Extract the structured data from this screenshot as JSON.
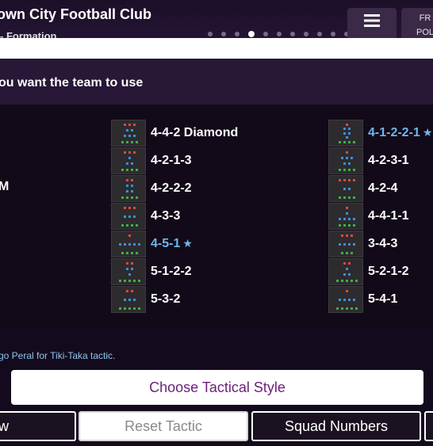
{
  "header": {
    "club_name": "own City Football Club",
    "subtitle": "- Formation",
    "page_count": 14,
    "active_page": 3,
    "right_button_label": "FR",
    "right_button_sub": "POL"
  },
  "question": "ou want the team to use",
  "left_label": "M",
  "formations": {
    "column1": [
      {
        "name": "4-4-2 Diamond",
        "highlight": false,
        "star": false,
        "lines": [
          [
            3
          ],
          [
            1,
            1
          ],
          [
            1,
            1,
            1
          ],
          [
            4
          ]
        ]
      },
      {
        "name": "4-2-1-3",
        "highlight": false,
        "star": false,
        "lines": [
          [
            3
          ],
          [
            1
          ],
          [
            2
          ],
          [
            4
          ]
        ]
      },
      {
        "name": "4-2-2-2",
        "highlight": false,
        "star": false,
        "lines": [
          [
            2
          ],
          [
            2
          ],
          [
            2
          ],
          [
            4
          ]
        ]
      },
      {
        "name": "4-3-3",
        "highlight": false,
        "star": false,
        "lines": [
          [
            3
          ],
          [
            3
          ],
          [
            4
          ]
        ]
      },
      {
        "name": "4-5-1",
        "highlight": true,
        "star": true,
        "lines": [
          [
            1
          ],
          [
            5
          ],
          [
            4
          ]
        ]
      },
      {
        "name": "5-1-2-2",
        "highlight": false,
        "star": false,
        "lines": [
          [
            2
          ],
          [
            2
          ],
          [
            1
          ],
          [
            5
          ]
        ]
      },
      {
        "name": "5-3-2",
        "highlight": false,
        "star": false,
        "lines": [
          [
            2
          ],
          [
            3
          ],
          [
            5
          ]
        ]
      }
    ],
    "column2": [
      {
        "name": "4-1-2-2-1",
        "highlight": true,
        "star": true,
        "lines": [
          [
            1
          ],
          [
            2
          ],
          [
            2
          ],
          [
            1
          ],
          [
            4
          ]
        ]
      },
      {
        "name": "4-2-3-1",
        "highlight": false,
        "star": false,
        "lines": [
          [
            1
          ],
          [
            3
          ],
          [
            2
          ],
          [
            4
          ]
        ]
      },
      {
        "name": "4-2-4",
        "highlight": false,
        "star": false,
        "lines": [
          [
            4
          ],
          [
            2
          ],
          [
            4
          ]
        ]
      },
      {
        "name": "4-4-1-1",
        "highlight": false,
        "star": false,
        "lines": [
          [
            1
          ],
          [
            1
          ],
          [
            4
          ],
          [
            4
          ]
        ]
      },
      {
        "name": "3-4-3",
        "highlight": false,
        "star": false,
        "lines": [
          [
            3
          ],
          [
            4
          ],
          [
            3
          ]
        ]
      },
      {
        "name": "5-2-1-2",
        "highlight": false,
        "star": false,
        "lines": [
          [
            2
          ],
          [
            1
          ],
          [
            2
          ],
          [
            5
          ]
        ]
      },
      {
        "name": "5-4-1",
        "highlight": false,
        "star": false,
        "lines": [
          [
            1
          ],
          [
            4
          ],
          [
            5
          ]
        ]
      }
    ]
  },
  "star_glyph": "★",
  "hint": "go Peral for Tiki-Taka tactic.",
  "tactical_style_button": "Choose Tactical Style",
  "bottom_buttons": {
    "left": "w",
    "reset": "Reset Tactic",
    "squad": "Squad Numbers"
  },
  "colors": {
    "attack": "#e0473f",
    "midfield": "#3b8fd8",
    "defense": "#3fae4a",
    "highlight": "#6fb6e8",
    "tactical_button_text": "#6a1f78"
  },
  "icons": {
    "menu": "menu-icon",
    "star": "star-icon"
  }
}
